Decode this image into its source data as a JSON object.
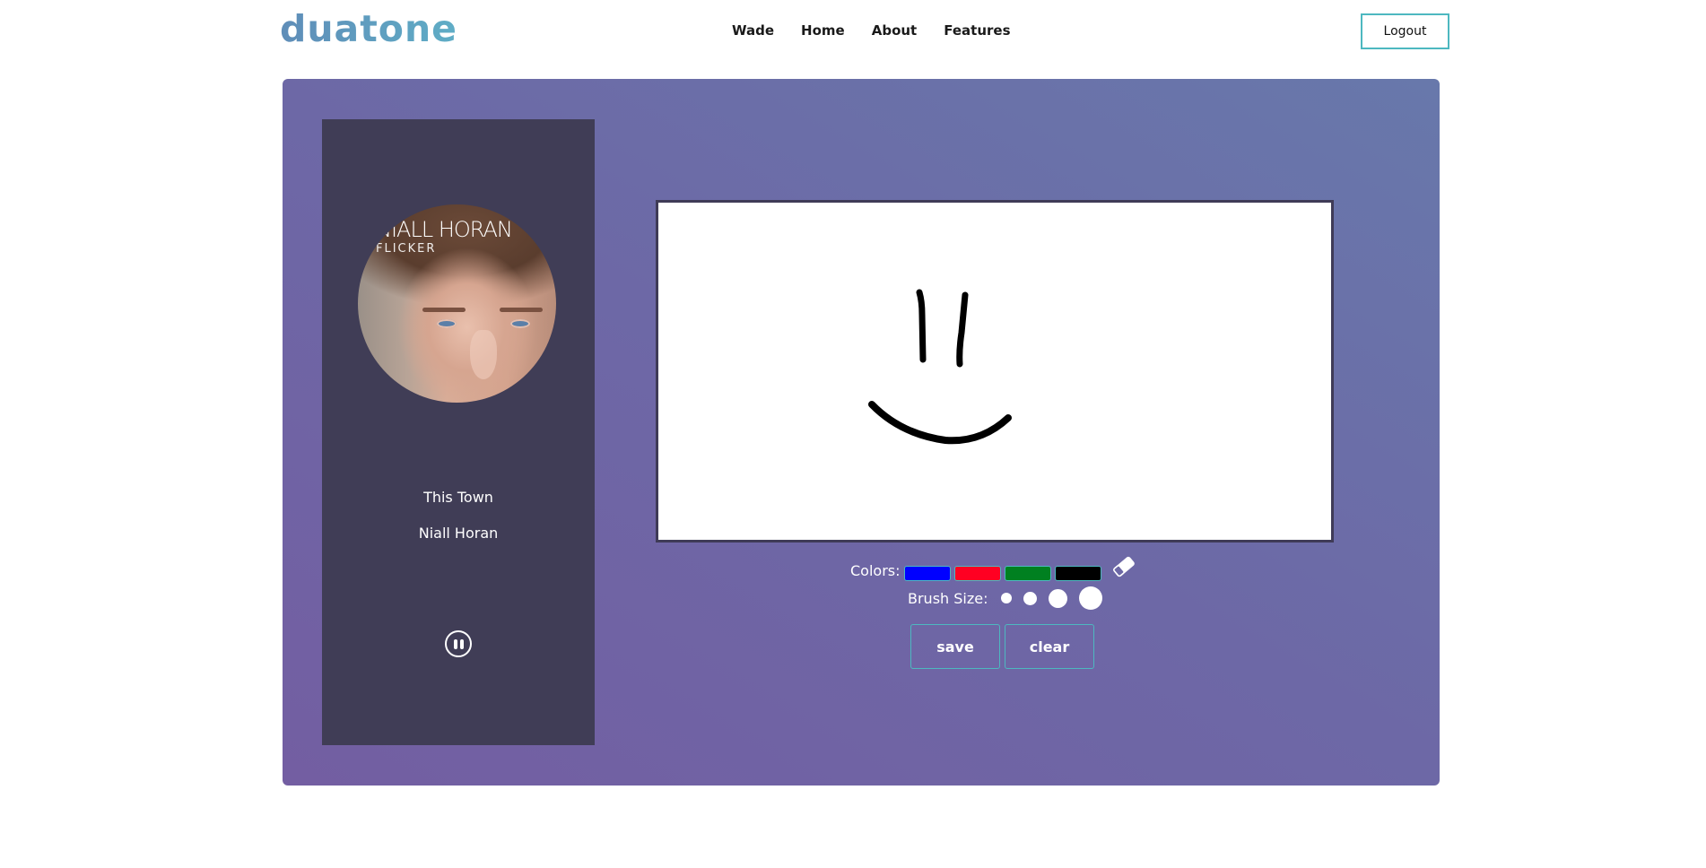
{
  "header": {
    "logo": "duatone",
    "nav": [
      "Wade",
      "Home",
      "About",
      "Features"
    ],
    "logout_label": "Logout"
  },
  "player": {
    "album_art_text": [
      "NIALL HORAN",
      "FLICKER"
    ],
    "song_title": "This Town",
    "artist": "Niall Horan",
    "state": "playing",
    "control_icon": "pause-icon"
  },
  "drawing": {
    "colors_label": "Colors:",
    "colors": [
      {
        "name": "blue",
        "hex": "#0000ff"
      },
      {
        "name": "red",
        "hex": "#ff0022"
      },
      {
        "name": "green",
        "hex": "#008020"
      },
      {
        "name": "black",
        "hex": "#000000"
      }
    ],
    "eraser_icon": "eraser-icon",
    "brush_label": "Brush Size:",
    "brush_sizes": [
      "small",
      "medium",
      "large",
      "extra-large"
    ],
    "stroke_color": "#000000",
    "save_label": "save",
    "clear_label": "clear"
  },
  "theme": {
    "card_gradient": [
      "#735ea2",
      "#6878ab"
    ],
    "player_bg": "#403d56",
    "accent": "#4db8c0"
  }
}
